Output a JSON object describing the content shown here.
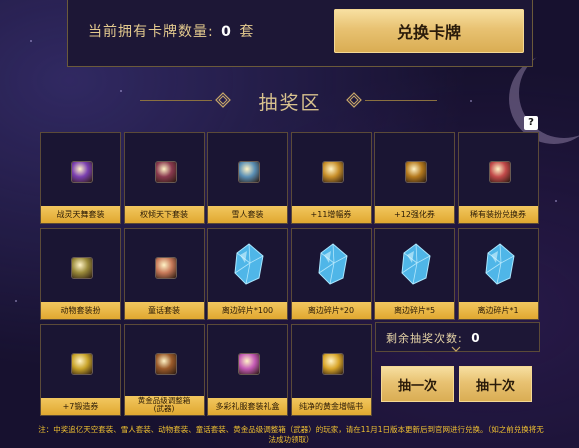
{
  "header": {
    "card_count_label": "当前拥有卡牌数量:",
    "card_count": "0",
    "card_unit": "套",
    "redeem_button": "兑换卡牌"
  },
  "section": {
    "title": "抽奖区",
    "help": "?"
  },
  "prizes": [
    {
      "label": "战灵天舞套装",
      "icon": "purple-costume-box-icon",
      "color": "#7a3fb0"
    },
    {
      "label": "权倾天下套装",
      "icon": "purple-costume-box-icon",
      "color": "#8a3a4f"
    },
    {
      "label": "雪人套装",
      "icon": "snowman-costume-box-icon",
      "color": "#5a8fb5"
    },
    {
      "label": "+11增幅券",
      "icon": "amplify-ticket-icon",
      "color": "#c88f2a"
    },
    {
      "label": "+12强化券",
      "icon": "enhance-ticket-icon",
      "color": "#b57a1e"
    },
    {
      "label": "稀有装扮兑换券",
      "icon": "rare-avatar-voucher-icon",
      "color": "#c24a4a"
    },
    {
      "label": "动物套装扮",
      "icon": "animal-costume-box-icon",
      "color": "#9a8a3a"
    },
    {
      "label": "童话套装",
      "icon": "fairytale-costume-box-icon",
      "color": "#c87a5a"
    },
    {
      "label": "离边碎片*100",
      "icon": "blue-crystal-icon",
      "color": "#4fb6e8"
    },
    {
      "label": "离边碎片*20",
      "icon": "blue-crystal-icon",
      "color": "#4fb6e8"
    },
    {
      "label": "离边碎片*5",
      "icon": "blue-crystal-icon",
      "color": "#4fb6e8"
    },
    {
      "label": "离边碎片*1",
      "icon": "blue-crystal-icon",
      "color": "#4fb6e8"
    },
    {
      "label": "+7锻造券",
      "icon": "forge-ticket-icon",
      "color": "#c9a42a"
    },
    {
      "label": "黄金品级调整箱\n(武器)",
      "icon": "gold-adjust-box-icon",
      "color": "#9a5a2a"
    },
    {
      "label": "多彩礼服套装礼盒",
      "icon": "colorful-gift-box-icon",
      "color": "#c45ab5"
    },
    {
      "label": "纯净的黄金增幅书",
      "icon": "gold-amplify-book-icon",
      "color": "#d9a62a"
    }
  ],
  "draw": {
    "remaining_label": "剩余抽奖次数:",
    "remaining": "0",
    "draw_once": "抽一次",
    "draw_ten": "抽十次"
  },
  "note": "注：中奖追亿天空套装、雪人套装、动物套装、童话套装、黄金品级调整箱（武器）的玩家，请在11月1日版本更新后到官网进行兑换。（如之前兑换将无法成功领取）"
}
